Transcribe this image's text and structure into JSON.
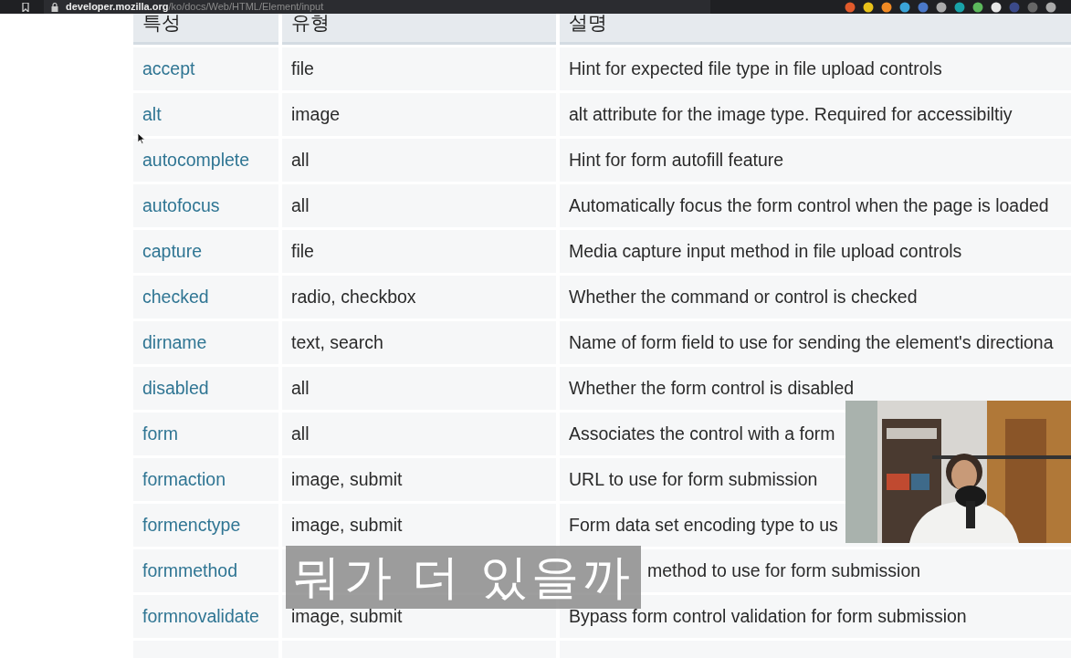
{
  "browser": {
    "url_host": "developer.mozilla.org",
    "url_path": "/ko/docs/Web/HTML/Element/input"
  },
  "table": {
    "columns": [
      "특성",
      "유형",
      "설명"
    ],
    "rows": [
      {
        "attribute": "accept",
        "type": "file",
        "description": "Hint for expected file type in file upload controls"
      },
      {
        "attribute": "alt",
        "type": "image",
        "description": "alt attribute for the image type. Required for accessibiltiy"
      },
      {
        "attribute": "autocomplete",
        "type": "all",
        "description": "Hint for form autofill feature"
      },
      {
        "attribute": "autofocus",
        "type": "all",
        "description": "Automatically focus the form control when the page is loaded"
      },
      {
        "attribute": "capture",
        "type": "file",
        "description": "Media capture input method in file upload controls"
      },
      {
        "attribute": "checked",
        "type": "radio, checkbox",
        "description": "Whether the command or control is checked"
      },
      {
        "attribute": "dirname",
        "type": "text, search",
        "description": "Name of form field to use for sending the element's directiona"
      },
      {
        "attribute": "disabled",
        "type": "all",
        "description": "Whether the form control is disabled"
      },
      {
        "attribute": "form",
        "type": "all",
        "description": "Associates the control with a form"
      },
      {
        "attribute": "formaction",
        "type": "image, submit",
        "description": "URL to use for form submission"
      },
      {
        "attribute": "formenctype",
        "type": "image, submit",
        "description": "Form data set encoding type to us"
      },
      {
        "attribute": "formmethod",
        "covered": true,
        "description": "method to use for form submission"
      },
      {
        "attribute": "formnovalidate",
        "type": "image, submit",
        "description": "Bypass form control validation for form submission"
      }
    ]
  },
  "subtitle": "뭐가 더 있을까"
}
